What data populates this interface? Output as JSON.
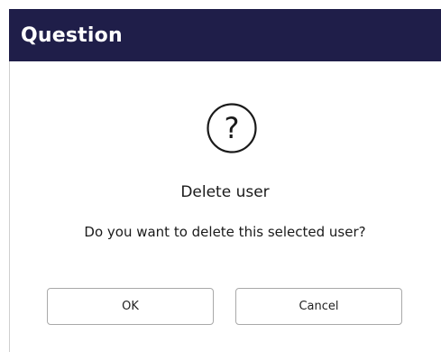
{
  "dialog": {
    "title": "Question",
    "icon": "question-circle-icon",
    "heading": "Delete user",
    "message": "Do you want to delete this selected user?",
    "ok_label": "OK",
    "cancel_label": "Cancel",
    "titlebar_color": "#1f1e49"
  }
}
